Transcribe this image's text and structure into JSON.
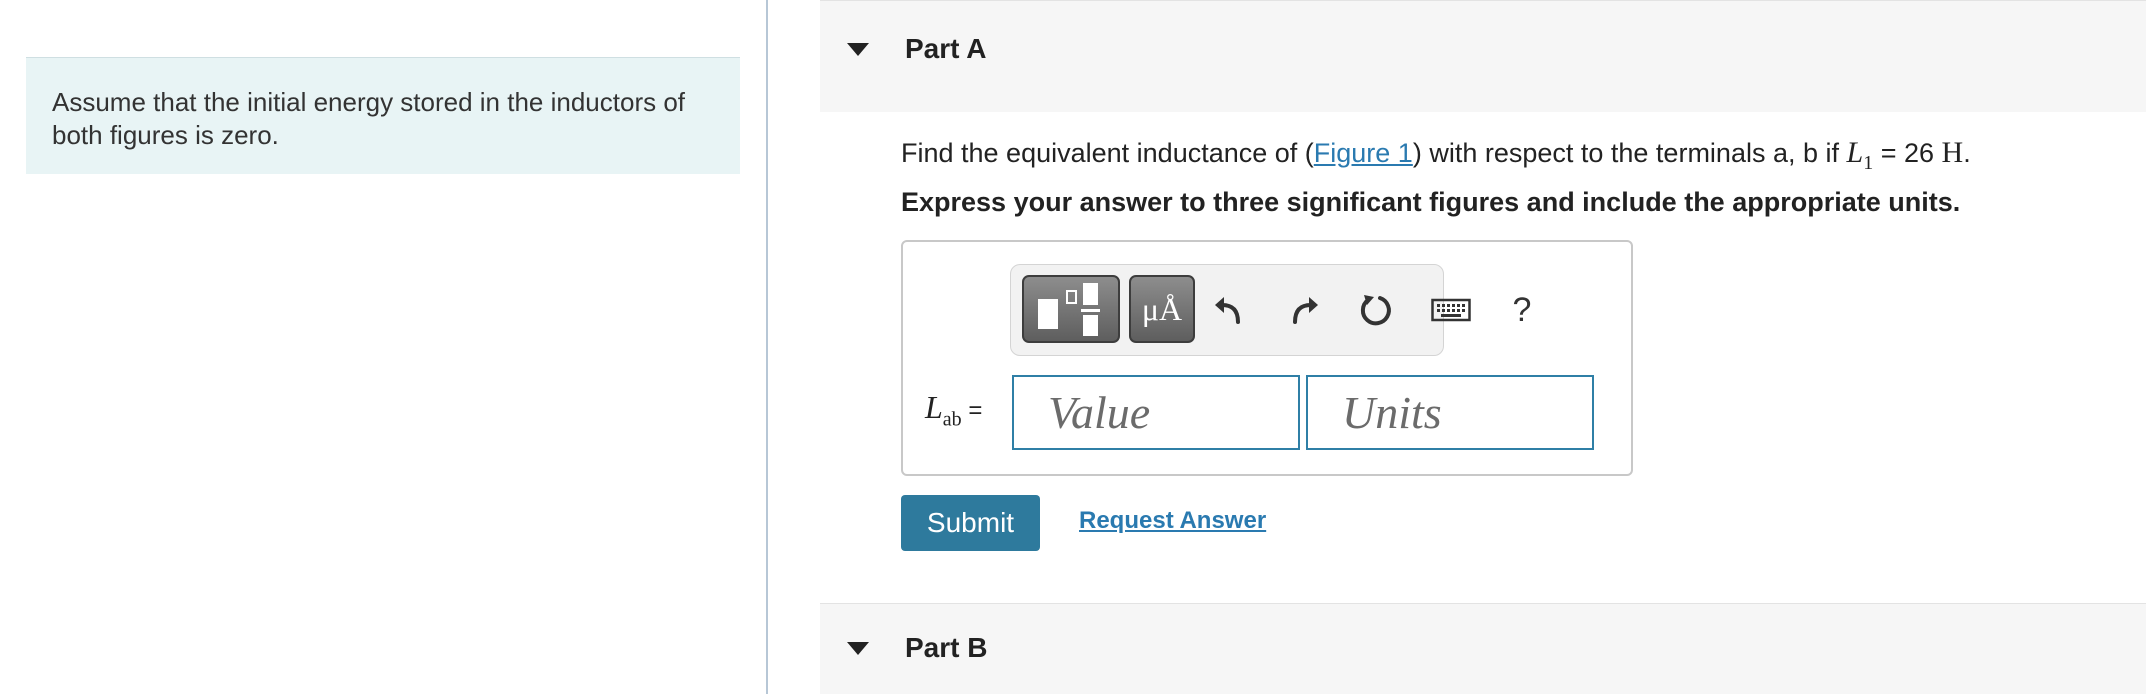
{
  "left_panel": {
    "note_line1": "Assume that the initial energy stored in the inductors of",
    "note_line2": "both figures is zero."
  },
  "part_a": {
    "title": "Part A",
    "question_prefix": "Find the equivalent inductance of (",
    "figure_link": "Figure 1",
    "question_middle": ") with respect to the terminals a, b if",
    "var_symbol": "L",
    "var_subscript": "1",
    "equals_value": " = 26",
    "unit": "H",
    "period": ".",
    "instruction": "Express your answer to three significant figures and include the appropriate units.",
    "toolbar": {
      "templates_icon": "templates-icon",
      "symbols_label": "μÅ",
      "undo_icon": "undo-icon",
      "redo_icon": "redo-icon",
      "reset_icon": "reset-icon",
      "keyboard_icon": "keyboard-icon",
      "help_label": "?"
    },
    "answer_label_symbol": "L",
    "answer_label_subscript": "ab",
    "answer_label_equals": " =",
    "value_placeholder": "Value",
    "units_placeholder": "Units",
    "submit_label": "Submit",
    "request_label": "Request Answer"
  },
  "part_b": {
    "title": "Part B"
  },
  "colors": {
    "link": "#2a7ab0",
    "submit_bg": "#2e7a9d",
    "note_bg": "#e8f4f5",
    "field_border": "#2f7fa6"
  }
}
